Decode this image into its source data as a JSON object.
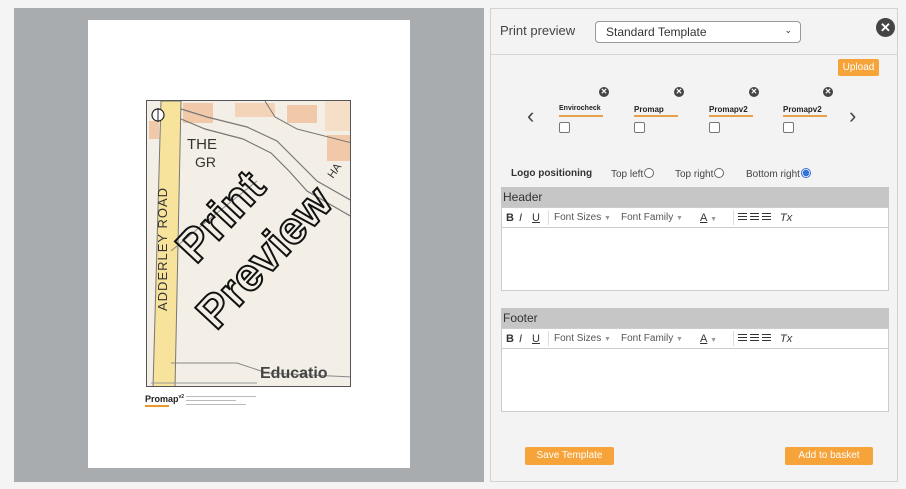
{
  "panel": {
    "title": "Print preview",
    "template_select": "Standard Template",
    "upload_label": "Upload",
    "logo_positioning_label": "Logo positioning",
    "position_options": [
      {
        "label": "Top left",
        "selected": false
      },
      {
        "label": "Top right",
        "selected": false
      },
      {
        "label": "Bottom right",
        "selected": true
      }
    ],
    "logos": [
      {
        "name": "Envirocheck",
        "checked": false
      },
      {
        "name": "Promap",
        "checked": false
      },
      {
        "name": "Promapv2",
        "checked": false
      },
      {
        "name": "Promapv2",
        "checked": false
      }
    ],
    "header": {
      "title": "Header"
    },
    "footer": {
      "title": "Footer"
    },
    "toolbar": {
      "bold": "B",
      "italic": "I",
      "underline": "U",
      "font_sizes": "Font Sizes",
      "font_family": "Font Family",
      "font_color": "A",
      "clear_format": "Tx"
    },
    "save_template_label": "Save Template",
    "add_to_basket_label": "Add to basket"
  },
  "preview": {
    "watermark_line1": "Print",
    "watermark_line2": "Preview",
    "map_label_the": "THE",
    "map_label_gr": "GR",
    "road_label": "ADDERLEY ROAD",
    "map_label_education": "Educatio",
    "map_label_ha": "HA",
    "footer_logo": "Promap",
    "footer_logo_version": "v2"
  },
  "colors": {
    "accent_orange": "#f6a33a",
    "radio_selected": "#3573d6",
    "preview_bg": "#a9acae"
  }
}
